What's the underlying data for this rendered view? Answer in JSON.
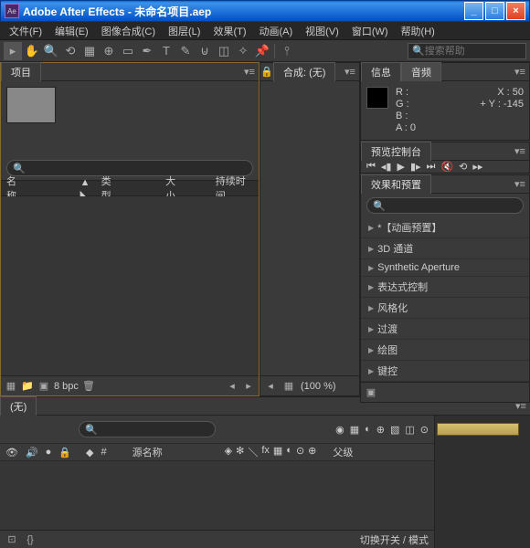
{
  "title": "Adobe After Effects - 未命名项目.aep",
  "menu": [
    "文件(F)",
    "编辑(E)",
    "图像合成(C)",
    "图层(L)",
    "效果(T)",
    "动画(A)",
    "视图(V)",
    "窗口(W)",
    "帮助(H)"
  ],
  "toolbar_search_placeholder": "搜索帮助",
  "project": {
    "tab": "项目",
    "columns": {
      "name": "名称",
      "type": "类型",
      "size": "大小",
      "duration": "持续时间"
    },
    "bpc": "8 bpc"
  },
  "composition": {
    "tab": "合成: (无)",
    "zoom": "(100 %)"
  },
  "info": {
    "tab_info": "信息",
    "tab_audio": "音频",
    "r": "R :",
    "g": "G :",
    "b": "B :",
    "a": "A : 0",
    "x": "X : 50",
    "y": "Y : -145"
  },
  "preview": {
    "tab": "预览控制台"
  },
  "effects": {
    "tab": "效果和预置",
    "items": [
      "*【动画预置】",
      "3D 通道",
      "Synthetic Aperture",
      "表达式控制",
      "风格化",
      "过渡",
      "绘图",
      "键控"
    ]
  },
  "timeline": {
    "tab": "(无)",
    "col_source": "源名称",
    "col_parent": "父级",
    "footer_label": "切换开关 / 模式"
  }
}
